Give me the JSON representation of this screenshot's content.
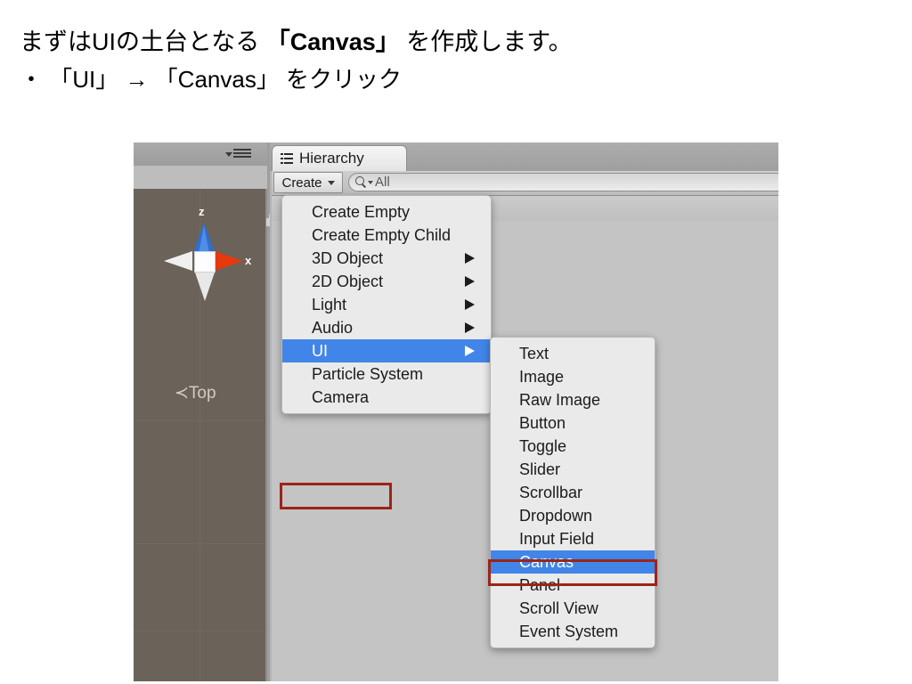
{
  "caption": {
    "line1_prefix": "まずはUIの土台となる ",
    "line1_strong": "「Canvas」",
    "line1_suffix": " を作成します。",
    "line2": "・ 「UI」 → 「Canvas」 をクリック"
  },
  "colors": {
    "menu_bg": "#eaeaea",
    "selection_blue": "#4285e8",
    "highlight_red": "#9c2418",
    "scene_bg": "#6b6259",
    "panel_bg": "#c4c4c4"
  },
  "scene_panel": {
    "gizmo": {
      "axis_z_label": "z",
      "axis_x_label": "x",
      "view_label": "≺Top",
      "lock_icon": "unlocked-padlock-icon"
    },
    "menu_icon": "hamburger-menu-icon"
  },
  "hierarchy_panel": {
    "tab_label": "Hierarchy",
    "tab_icon": "hierarchy-tree-icon",
    "lock_icon": "unlocked-padlock-icon",
    "menu_icon": "hamburger-menu-icon",
    "toolbar": {
      "create_label": "Create",
      "create_caret_icon": "chevron-down-icon",
      "search_icon": "search-magnifier-icon",
      "search_caret_icon": "chevron-down-icon",
      "search_value": "All"
    },
    "sub_toolbar_menu_icon": "hamburger-menu-icon"
  },
  "create_menu": {
    "items": [
      {
        "label": "Create Empty",
        "submenu": false,
        "selected": false
      },
      {
        "label": "Create Empty Child",
        "submenu": false,
        "selected": false
      },
      {
        "label": "3D Object",
        "submenu": true,
        "selected": false
      },
      {
        "label": "2D Object",
        "submenu": true,
        "selected": false
      },
      {
        "label": "Light",
        "submenu": true,
        "selected": false
      },
      {
        "label": "Audio",
        "submenu": true,
        "selected": false
      },
      {
        "label": "UI",
        "submenu": true,
        "selected": true
      },
      {
        "label": "Particle System",
        "submenu": false,
        "selected": false
      },
      {
        "label": "Camera",
        "submenu": false,
        "selected": false
      }
    ]
  },
  "ui_submenu": {
    "items": [
      {
        "label": "Text",
        "selected": false
      },
      {
        "label": "Image",
        "selected": false
      },
      {
        "label": "Raw Image",
        "selected": false
      },
      {
        "label": "Button",
        "selected": false
      },
      {
        "label": "Toggle",
        "selected": false
      },
      {
        "label": "Slider",
        "selected": false
      },
      {
        "label": "Scrollbar",
        "selected": false
      },
      {
        "label": "Dropdown",
        "selected": false
      },
      {
        "label": "Input Field",
        "selected": false
      },
      {
        "label": "Canvas",
        "selected": true
      },
      {
        "label": "Panel",
        "selected": false
      },
      {
        "label": "Scroll View",
        "selected": false
      },
      {
        "label": "Event System",
        "selected": false
      }
    ]
  }
}
